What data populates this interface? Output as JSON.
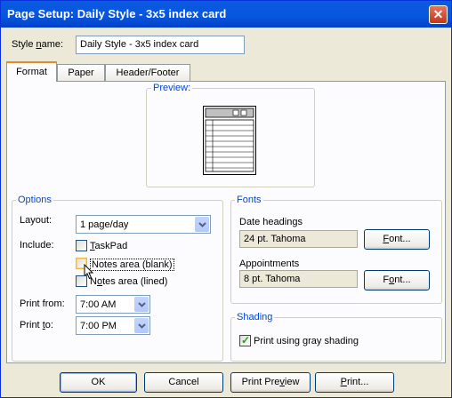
{
  "window": {
    "title": "Page Setup: Daily Style - 3x5 index card",
    "close_glyph": "✕"
  },
  "style_name": {
    "label_pre": "Style ",
    "label_key": "n",
    "label_post": "ame:",
    "value": "Daily Style - 3x5 index card"
  },
  "tabs": [
    {
      "label": "Format",
      "active": true
    },
    {
      "label": "Paper"
    },
    {
      "label": "Header/Footer"
    }
  ],
  "preview": {
    "label": "Preview:"
  },
  "options": {
    "label": "Options",
    "layout": {
      "label": "Layout:",
      "value": "1 page/day"
    },
    "include": {
      "label": "Include:"
    },
    "taskpad": {
      "key": "T",
      "rest": "askPad",
      "checked": false
    },
    "notes_blank": {
      "label": "Notes area (blank)",
      "checked": false
    },
    "notes_lined": {
      "pre": "N",
      "key": "o",
      "rest": "tes area (lined)",
      "checked": false
    },
    "print_from": {
      "label": "Print from:",
      "value": "7:00 AM"
    },
    "print_to": {
      "pre": "Print ",
      "key": "t",
      "rest": "o:",
      "value": "7:00 PM"
    }
  },
  "fonts": {
    "label": "Fonts",
    "date_headings": {
      "label": "Date headings",
      "value": "24 pt. Tahoma",
      "button_key": "F",
      "button_rest": "ont..."
    },
    "appointments": {
      "label": "Appointments",
      "value": "8 pt. Tahoma",
      "button_pre": "F",
      "button_key": "o",
      "button_rest": "nt..."
    }
  },
  "shading": {
    "label": "Shading",
    "gray": {
      "label": "Print using gray shading",
      "checked": true
    }
  },
  "buttons": {
    "ok": "OK",
    "cancel": "Cancel",
    "print_preview_pre": "Print Pre",
    "print_preview_key": "v",
    "print_preview_rest": "iew",
    "print_key": "P",
    "print_rest": "rint..."
  },
  "colors": {
    "titlebar": "#0a5be0",
    "group_label": "#0046d5",
    "focus": "#e68b2c"
  },
  "icons": [
    "close-icon",
    "dropdown-arrow-icon",
    "checkmark-icon",
    "cursor-pointer-icon",
    "page-preview-icon"
  ]
}
